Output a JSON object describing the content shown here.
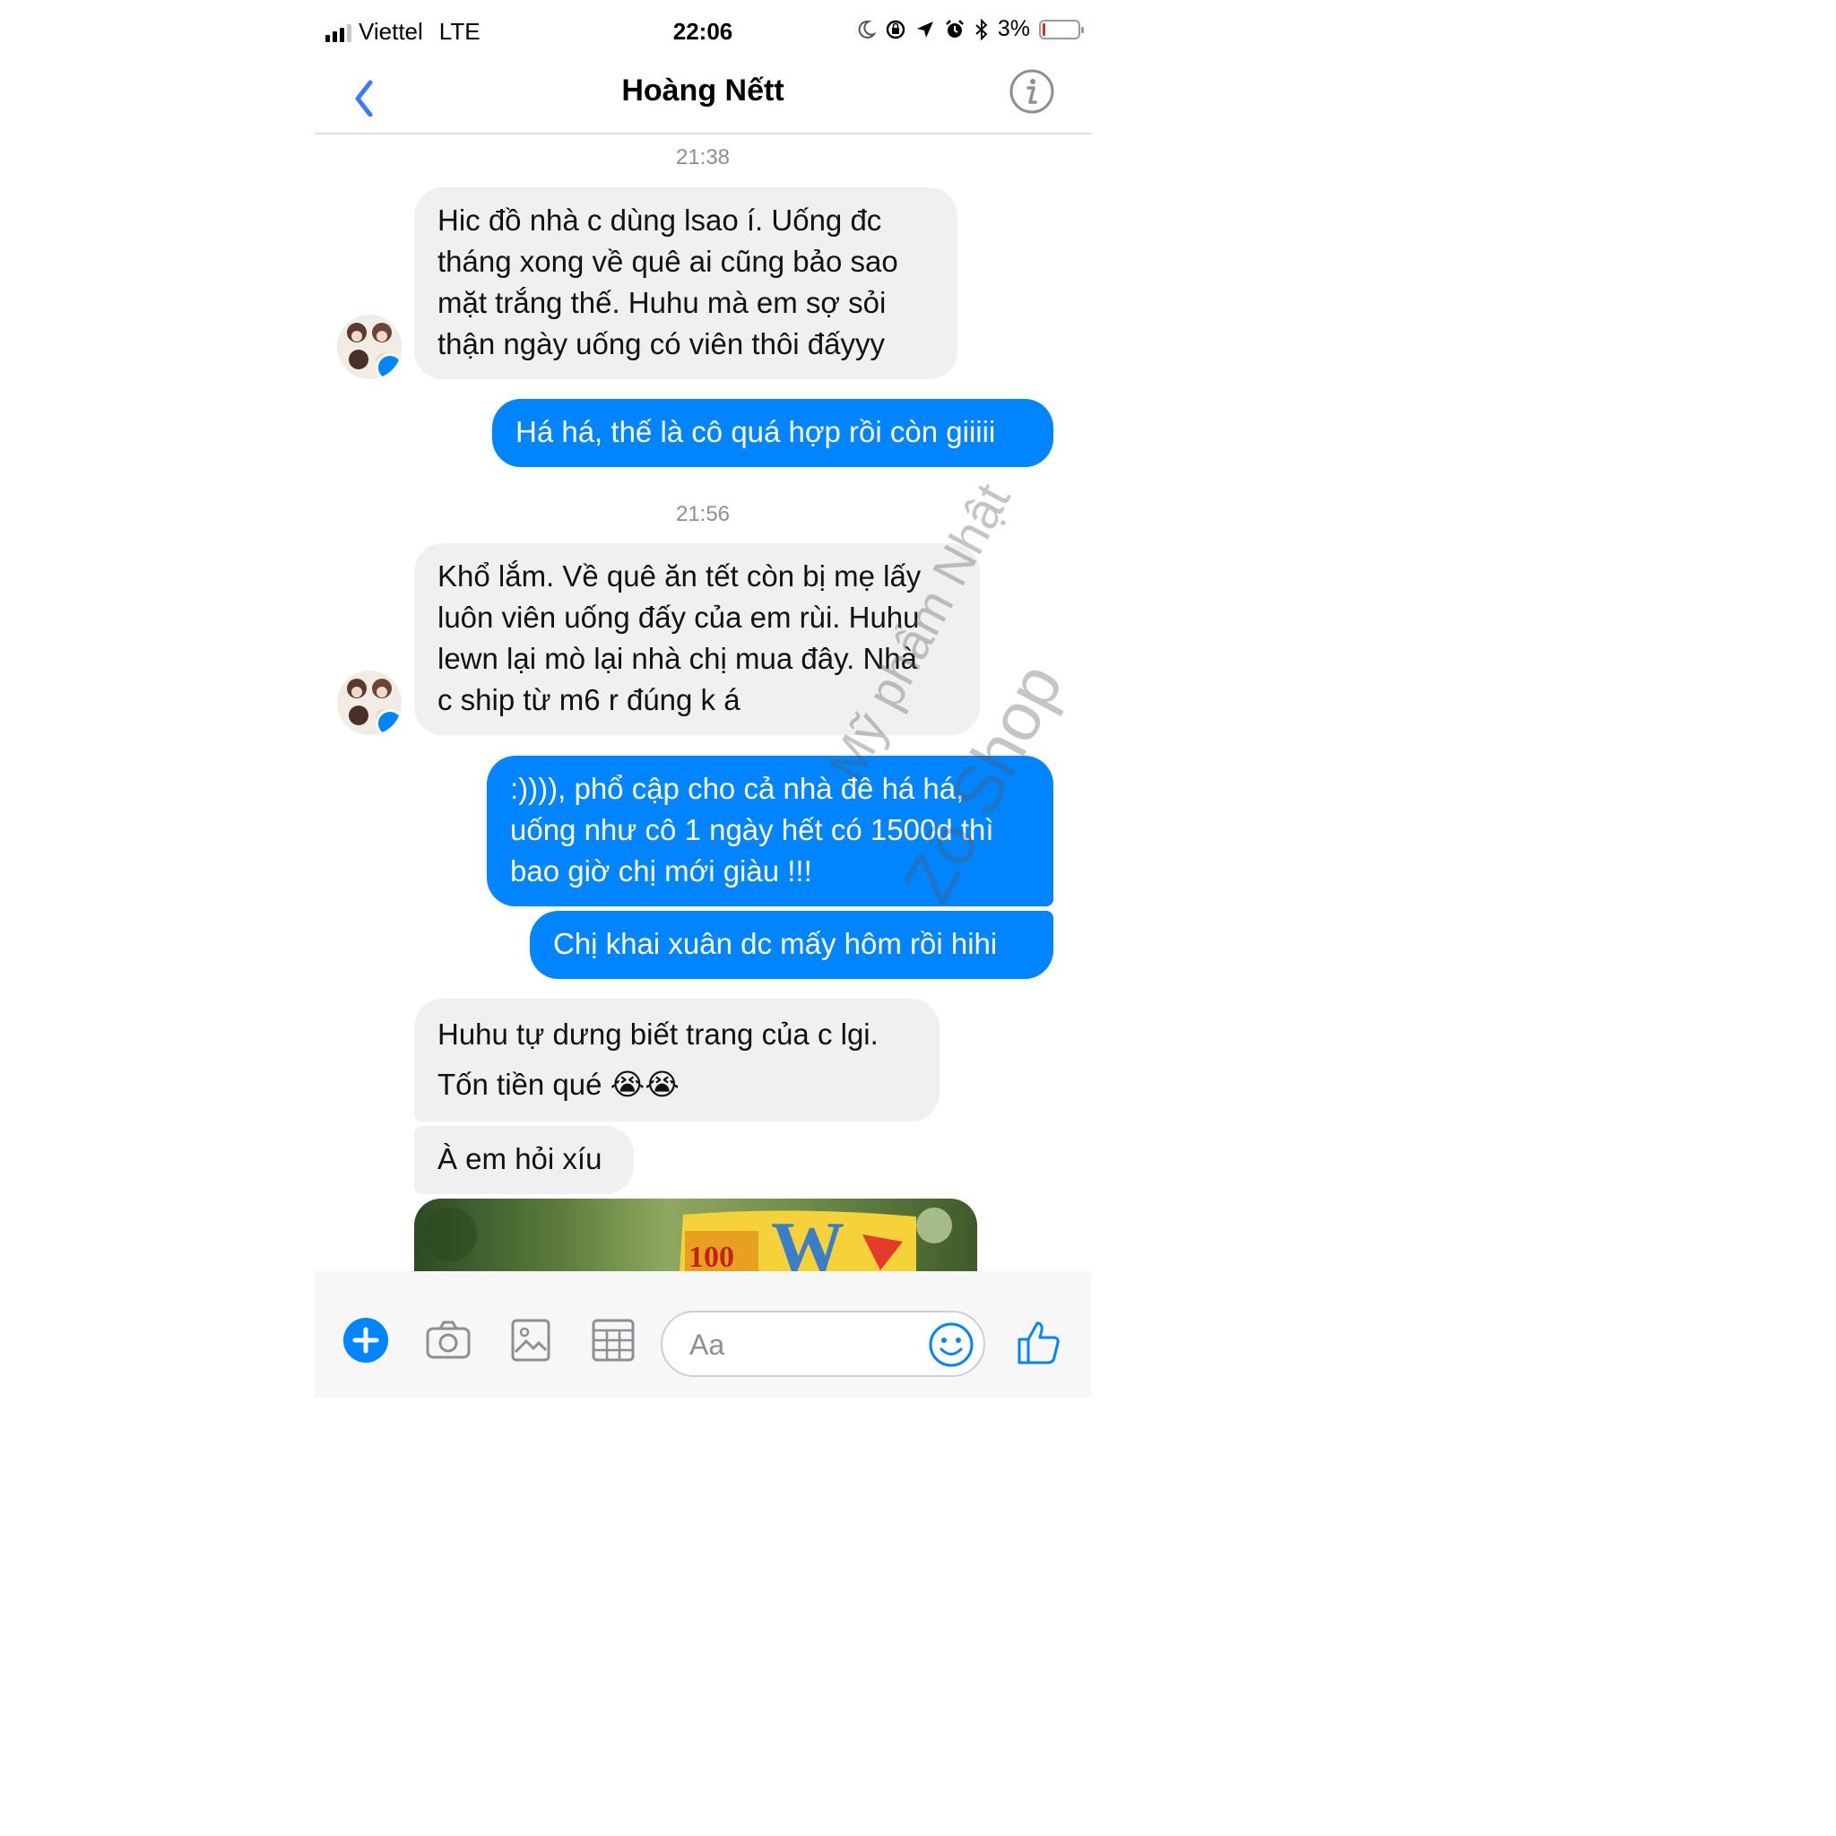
{
  "status_bar": {
    "carrier": "Viettel",
    "network": "LTE",
    "time": "22:06",
    "battery": "3%"
  },
  "header": {
    "title": "Hoàng Nếtt"
  },
  "timestamps": [
    "21:38",
    "21:56"
  ],
  "messages": [
    {
      "side": "in",
      "lines": [
        "Hic đồ nhà c dùng lsao í. Uống đc",
        "tháng xong về quê ai cũng bảo sao",
        "mặt trắng thế. Huhu mà em sợ sỏi",
        "thận ngày uống có viên thôi đấyyy"
      ]
    },
    {
      "side": "out",
      "lines": [
        "Há há, thế là cô quá hợp rồi còn giiiii"
      ]
    },
    {
      "side": "in",
      "lines": [
        "Khổ lắm. Về quê ăn tết còn bị mẹ lấy",
        "luôn viên uống đấy của em rùi. Huhu",
        "lewn lại mò lại nhà chị mua đây. Nhà",
        "c ship từ m6 r đúng k á"
      ]
    },
    {
      "side": "out",
      "lines": [
        ":)))), phổ cập cho cả nhà đê há há,",
        "uống như cô 1 ngày hết có 1500d thì",
        "bao giờ chị mới giàu !!!"
      ]
    },
    {
      "side": "out",
      "lines": [
        "Chị khai xuân dc mấy hôm rồi hihi"
      ]
    },
    {
      "side": "in",
      "lines": [
        "Huhu tự dưng biết trang của c lgi.",
        "Tốn tiền qué 😭😭"
      ]
    },
    {
      "side": "in",
      "lines": [
        "À em hỏi xíu"
      ]
    }
  ],
  "photo_text": {
    "badge": "100",
    "letter": "W"
  },
  "watermark": {
    "line1": "Mỹ phẩm Nhật",
    "line2": "Zô Shop"
  },
  "composer": {
    "placeholder": "Aa"
  },
  "colors": {
    "outgoing": "#0084ff",
    "incoming": "#f1f0f0",
    "accent": "#0084ff"
  }
}
